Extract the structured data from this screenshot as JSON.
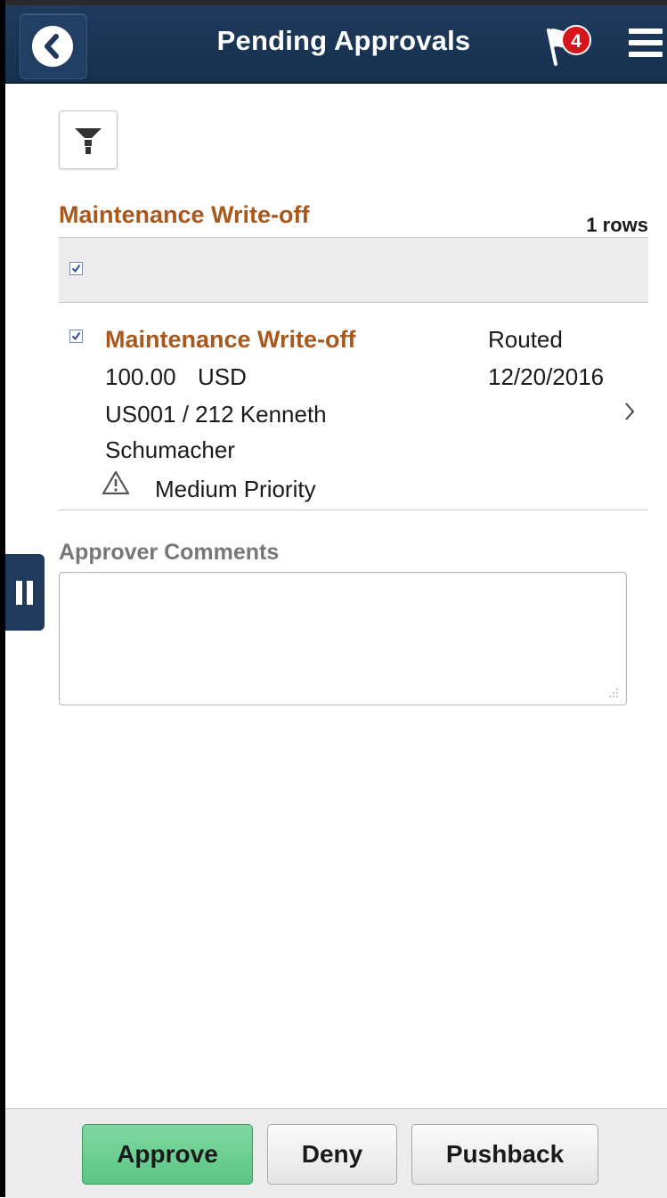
{
  "header": {
    "title": "Pending Approvals",
    "notification_count": "4"
  },
  "section": {
    "title": "Maintenance Write-off",
    "row_count": "1 rows"
  },
  "item": {
    "title": "Maintenance Write-off",
    "amount": "100.00",
    "currency": "USD",
    "requester_line1": "US001 / 212  Kenneth",
    "requester_line2": "Schumacher",
    "priority": "Medium Priority",
    "status": "Routed",
    "date": "12/20/2016",
    "checked": true
  },
  "comments": {
    "label": "Approver Comments",
    "value": ""
  },
  "footer": {
    "approve_label": "Approve",
    "deny_label": "Deny",
    "pushback_label": "Pushback"
  },
  "colors": {
    "header_bg": "#1f3a5c",
    "accent_orange": "#a8581c",
    "approve_green": "#5cc585",
    "badge_red": "#d7141a"
  },
  "icons": {
    "back": "back-arrow-icon",
    "notifications": "flag-icon",
    "menu": "hamburger-menu-icon",
    "filter": "filter-icon",
    "priority": "warning-triangle-icon",
    "detail": "chevron-right-icon",
    "side_panel": "pause-bars-icon"
  }
}
